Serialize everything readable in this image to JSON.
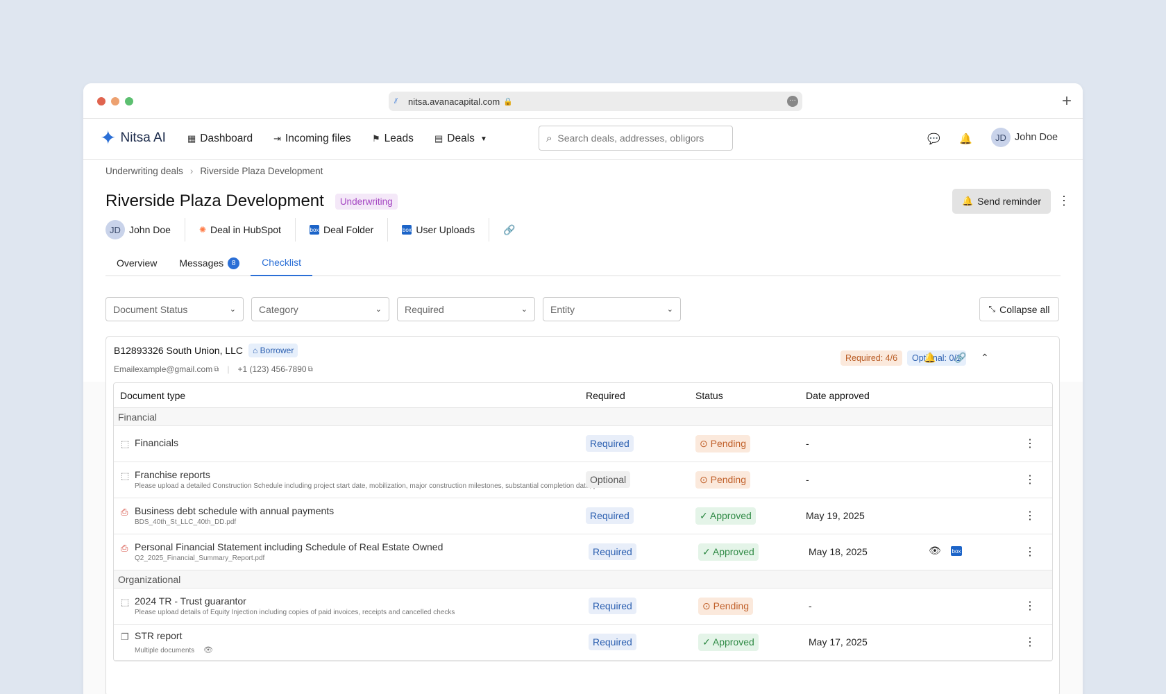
{
  "browser": {
    "url": "nitsa.avanacapital.com",
    "new_tab": "+"
  },
  "nav": {
    "brand": "Nitsa AI",
    "links": [
      "Dashboard",
      "Incoming files",
      "Leads",
      "Deals"
    ],
    "search_placeholder": "Search deals, addresses, obligors",
    "user_initials": "JD",
    "user_name": "John Doe"
  },
  "breadcrumb": {
    "parent": "Underwriting deals",
    "current": "Riverside Plaza Development"
  },
  "deal": {
    "title": "Riverside Plaza Development",
    "stage": "Underwriting",
    "send_reminder": "Send reminder",
    "owner_initials": "JD",
    "owner_name": "John Doe",
    "links": [
      "Deal in HubSpot",
      "Deal Folder",
      "User Uploads"
    ]
  },
  "tabs": {
    "overview": "Overview",
    "messages": "Messages",
    "messages_count": "8",
    "checklist": "Checklist"
  },
  "filters": {
    "status": "Document Status",
    "category": "Category",
    "required": "Required",
    "entity": "Entity",
    "collapse_all": "Collapse all"
  },
  "entity": {
    "name": "B12893326 South Union, LLC",
    "role": "Borrower",
    "email": "Emailexample@gmail.com",
    "phone": "+1 (123) 456-7890",
    "required_progress": "Required: 4/6",
    "optional_progress": "Optional: 0/1"
  },
  "table": {
    "headers": {
      "doc_type": "Document type",
      "required": "Required",
      "status": "Status",
      "date": "Date approved"
    },
    "groups": {
      "financial": "Financial",
      "organizational": "Organizational"
    },
    "rows": [
      {
        "name": "Financials",
        "sub": "",
        "required": "Required",
        "status": "Pending",
        "date": "-"
      },
      {
        "name": "Franchise reports",
        "sub": "Please upload a detailed Construction Schedule including project start date, mobilization, major construction milestones, substantial completion date, pu...",
        "required": "Optional",
        "status": "Pending",
        "date": "-"
      },
      {
        "name": "Business debt schedule with annual payments",
        "sub": "BDS_40th_St_LLC_40th_DD.pdf",
        "required": "Required",
        "status": "Approved",
        "date": "May 19, 2025"
      },
      {
        "name": "Personal Financial Statement including Schedule of Real Estate Owned",
        "sub": "Q2_2025_Financial_Summary_Report.pdf",
        "required": "Required",
        "status": "Approved",
        "date": "May 18, 2025"
      },
      {
        "name": "2024 TR - Trust guarantor",
        "sub": "Please upload details of Equity Injection including copies of paid invoices, receipts and cancelled checks",
        "required": "Required",
        "status": "Pending",
        "date": "-"
      },
      {
        "name": "STR report",
        "sub": "Multiple documents",
        "required": "Required",
        "status": "Approved",
        "date": "May 17, 2025"
      }
    ]
  }
}
